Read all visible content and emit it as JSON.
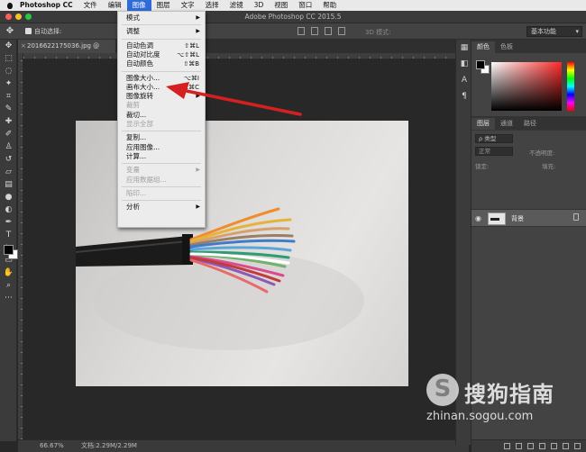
{
  "menubar": {
    "app": "Photoshop CC",
    "items": [
      "文件",
      "编辑",
      "图像",
      "图层",
      "文字",
      "选择",
      "滤镜",
      "3D",
      "视图",
      "窗口",
      "帮助"
    ],
    "active_index": 2
  },
  "window": {
    "title": "Adobe Photoshop CC 2015.5"
  },
  "options_bar": {
    "auto_select_label": "自动选择:",
    "workspace": "基本功能",
    "mode_3d": "3D 模式:"
  },
  "document": {
    "tab": "20166221750​36.jpg @"
  },
  "status": {
    "zoom": "66.67%",
    "docsize": "文档:2.29M/2.29M"
  },
  "image_menu": {
    "items": [
      {
        "label": "模式",
        "submenu": true
      },
      {
        "sep": true
      },
      {
        "label": "调整",
        "submenu": true
      },
      {
        "sep": true
      },
      {
        "label": "自动色调",
        "shortcut": "⇧⌘L"
      },
      {
        "label": "自动对比度",
        "shortcut": "⌥⇧⌘L"
      },
      {
        "label": "自动颜色",
        "shortcut": "⇧⌘B"
      },
      {
        "sep": true
      },
      {
        "label": "图像大小...",
        "shortcut": "⌥⌘I"
      },
      {
        "label": "画布大小...",
        "shortcut": "⌥⌘C"
      },
      {
        "label": "图像旋转",
        "submenu": true
      },
      {
        "label": "裁剪",
        "disabled": true
      },
      {
        "label": "裁切..."
      },
      {
        "label": "显示全部",
        "disabled": true
      },
      {
        "sep": true
      },
      {
        "label": "复制..."
      },
      {
        "label": "应用图像..."
      },
      {
        "label": "计算..."
      },
      {
        "sep": true
      },
      {
        "label": "变量",
        "submenu": true,
        "disabled": true
      },
      {
        "label": "应用数据组...",
        "disabled": true
      },
      {
        "sep": true
      },
      {
        "label": "陷印...",
        "disabled": true
      },
      {
        "sep": true
      },
      {
        "label": "分析",
        "submenu": true
      }
    ]
  },
  "panels": {
    "color_tabs": [
      "颜色",
      "色板"
    ],
    "layer_tabs": [
      "图层",
      "通道",
      "路径"
    ],
    "filter_label": "ρ 类型",
    "blend_mode": "正常",
    "opacity_label": "不透明度:",
    "lock_label": "锁定:",
    "fill_label": "填充:",
    "layer_name": "背景"
  },
  "watermark": {
    "brand": "搜狗指南",
    "url": "zhinan.sogou.com"
  },
  "colors": {
    "accent": "#2f6bd9",
    "arrow": "#d42020",
    "menu_bg": "#ececec",
    "canvas_bg": "#282828"
  }
}
